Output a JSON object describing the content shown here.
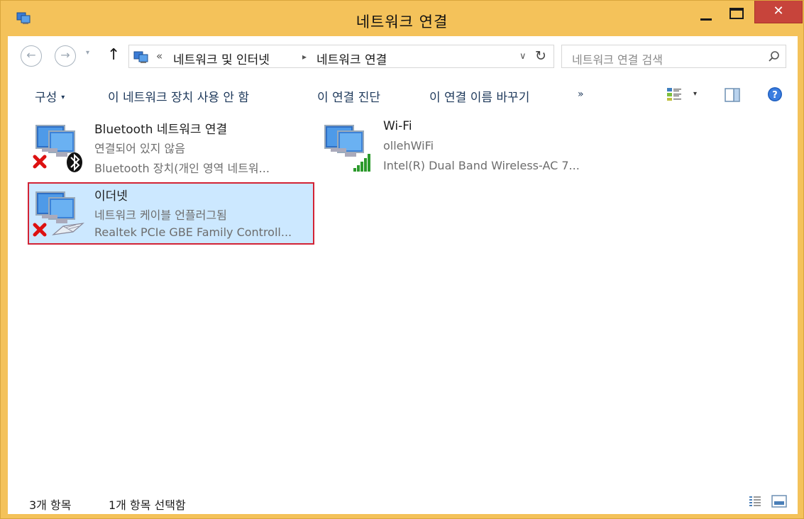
{
  "window": {
    "title": "네트워크 연결",
    "close_glyph": "✕"
  },
  "address_bar": {
    "back_glyph": "←",
    "forward_glyph": "→",
    "recent_glyph": "▾",
    "up_glyph": "↑",
    "overflow_glyph": "«",
    "breadcrumbs": [
      "네트워크 및 인터넷",
      "네트워크 연결"
    ],
    "separator_glyph": "▸",
    "dropdown_glyph": "∨",
    "refresh_glyph": "↻"
  },
  "search": {
    "placeholder": "네트워크 연결 검색"
  },
  "toolbar": {
    "organize_label": "구성",
    "caret_glyph": "▾",
    "disable_label": "이 네트워크 장치 사용 안 함",
    "diagnose_label": "이 연결 진단",
    "rename_label": "이 연결 이름 바꾸기",
    "more_glyph": "»"
  },
  "connections": [
    {
      "name": "Bluetooth 네트워크 연결",
      "status": "연결되어 있지 않음",
      "device": "Bluetooth 장치(개인 영역 네트워...",
      "icon": "bluetooth-network-icon",
      "disconnected": true,
      "selected": false
    },
    {
      "name": "Wi-Fi",
      "status": "ollehWiFi",
      "device": "Intel(R) Dual Band Wireless-AC 7...",
      "icon": "wifi-network-icon",
      "disconnected": false,
      "selected": false
    },
    {
      "name": "이더넷",
      "status": "네트워크 케이블 언플러그됨",
      "device": "Realtek PCIe GBE Family Controll...",
      "icon": "ethernet-network-icon",
      "disconnected": true,
      "selected": true
    }
  ],
  "statusbar": {
    "item_count": "3개 항목",
    "selected_count": "1개 항목 선택함"
  },
  "colors": {
    "titlebar": "#f4c25a",
    "close": "#c7443b",
    "selection_bg": "#cce8ff",
    "highlight_border": "#d22335",
    "link_text": "#1e395b"
  }
}
